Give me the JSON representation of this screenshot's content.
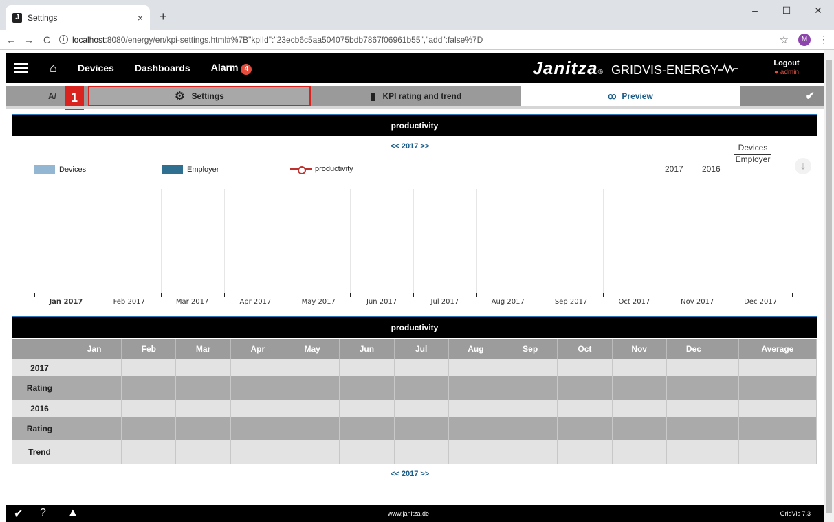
{
  "browser": {
    "tab_title": "Settings",
    "url_host": "localhost",
    "url_rest": ":8080/energy/en/kpi-settings.html#%7B\"kpiId\":\"23ecb6c5aa504075bdb7867f06961b55\",\"add\":false%7D",
    "profile_initial": "M"
  },
  "app": {
    "menu": {
      "devices": "Devices",
      "dashboards": "Dashboards",
      "alarm": "Alarm",
      "alarm_count": "4"
    },
    "brand": "Janitza",
    "brand_reg": "®",
    "product": "GRIDVIS-ENERGY",
    "logout": "Logout",
    "user": "admin"
  },
  "subnav": {
    "all": "A/",
    "marker": "1",
    "settings": "Settings",
    "kpi": "KPI rating and trend",
    "preview": "Preview"
  },
  "chart_section": {
    "title": "productivity",
    "year_nav": "<<  2017  >>",
    "years": [
      "2017",
      "2016"
    ],
    "selector": {
      "first": "Devices",
      "second": "Employer"
    }
  },
  "chart_data": {
    "type": "bar",
    "title": "productivity",
    "categories": [
      "Jan 2017",
      "Feb 2017",
      "Mar 2017",
      "Apr 2017",
      "May 2017",
      "Jun 2017",
      "Jul 2017",
      "Aug 2017",
      "Sep 2017",
      "Oct 2017",
      "Nov 2017",
      "Dec 2017"
    ],
    "series": [
      {
        "name": "Devices",
        "type": "bar",
        "color": "#93b7d3",
        "values": []
      },
      {
        "name": "Employer",
        "type": "bar",
        "color": "#2f6f8f",
        "values": []
      },
      {
        "name": "productivity",
        "type": "line",
        "color": "#c0302d",
        "values": []
      }
    ]
  },
  "table": {
    "title": "productivity",
    "columns": [
      "Jan",
      "Feb",
      "Mar",
      "Apr",
      "May",
      "Jun",
      "Jul",
      "Aug",
      "Sep",
      "Oct",
      "Nov",
      "Dec",
      "",
      "Average"
    ],
    "rows": [
      "2017",
      "Rating",
      "2016",
      "Rating",
      "Trend"
    ],
    "year_nav": "<<  2017  >>"
  },
  "footer": {
    "site": "www.janitza.de",
    "version": "GridVis 7.3"
  }
}
